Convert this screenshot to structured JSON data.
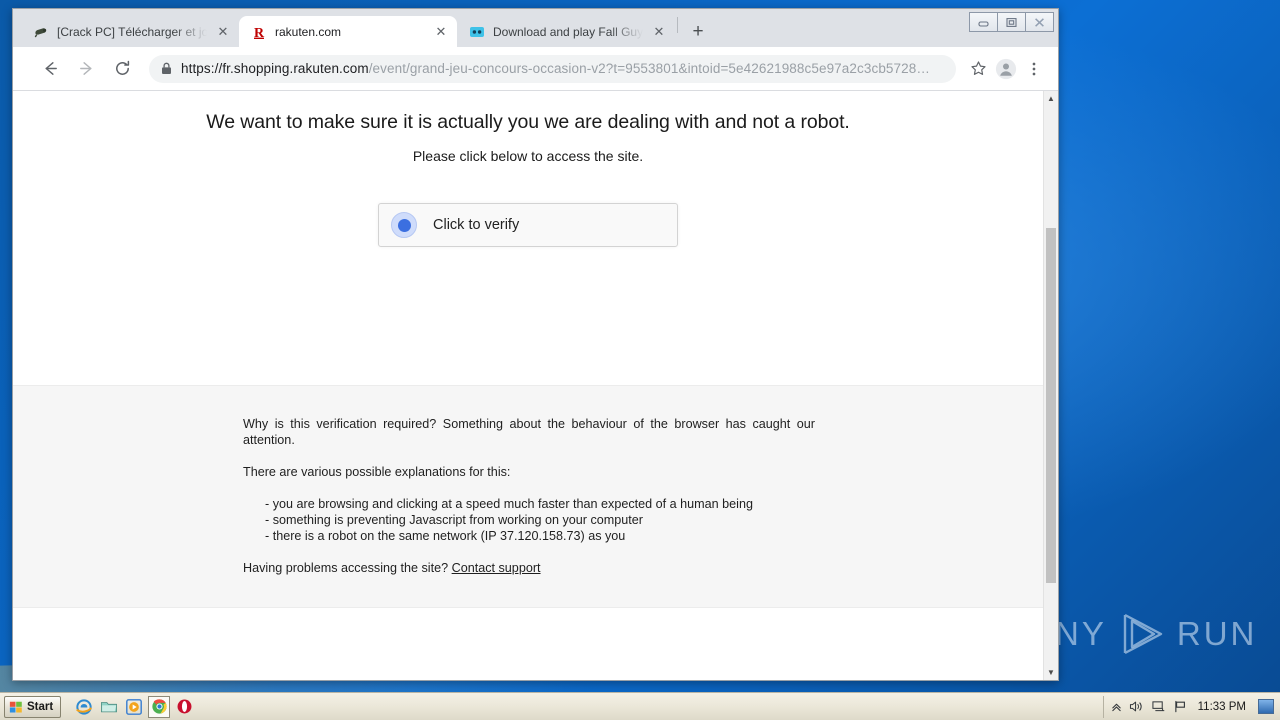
{
  "window": {
    "controls": [
      {
        "name": "minimize",
        "glyph": "minimize-icon"
      },
      {
        "name": "restore",
        "glyph": "restore-icon"
      },
      {
        "name": "close",
        "glyph": "close-icon"
      }
    ]
  },
  "browser": {
    "tabs": [
      {
        "title": "[Crack PC] Télécharger et jouer le je",
        "favicon": "gamepad-icon",
        "active": false
      },
      {
        "title": "rakuten.com",
        "favicon": "rakuten-r-icon",
        "active": true
      },
      {
        "title": "Download and play Fall Guys: Ultima",
        "favicon": "fallguys-icon",
        "active": false
      }
    ],
    "new_tab_label": "+",
    "tab_close_label": "✕",
    "nav": {
      "back": "back-arrow",
      "forward": "forward-arrow",
      "reload": "reload-icon"
    },
    "omnibox": {
      "lock": "lock-icon",
      "url_scheme_host": "https://fr.shopping.rakuten.com",
      "url_path": "/event/grand-jeu-concours-occasion-v2?t=9553801&intoid=5e42621988c5e97a2c3cb5728…",
      "url_full": "https://fr.shopping.rakuten.com/event/grand-jeu-concours-occasion-v2?t=9553801&intoid=5e42621988c5e97a2c3cb5728…"
    },
    "actions": {
      "bookmark": "star-icon",
      "profile": "avatar-icon",
      "menu": "three-dot-menu-icon"
    }
  },
  "page": {
    "headline": "We want to make sure it is actually you we are dealing with and not a robot.",
    "subline": "Please click below to access the site.",
    "verify_button_label": "Click to verify",
    "footer": {
      "why_paragraph": "Why is this verification required? Something about the behaviour of the browser has caught our attention.",
      "explanations_intro": "There are various possible explanations for this:",
      "explanations": [
        "- you are browsing and clicking at a speed much faster than expected of a human being",
        "- something is preventing Javascript from working on your computer",
        "- there is a robot on the same network (IP 37.120.158.73) as you"
      ],
      "help_prefix": "Having problems accessing the site? ",
      "contact_link": "Contact support"
    },
    "scrollbar": {
      "up_arrow": "▲",
      "down_arrow": "▼"
    }
  },
  "taskbar": {
    "start_label": "Start",
    "quicklaunch": [
      {
        "name": "internet-explorer-icon"
      },
      {
        "name": "file-explorer-icon"
      },
      {
        "name": "media-player-icon"
      },
      {
        "name": "google-chrome-icon"
      },
      {
        "name": "opera-icon"
      }
    ],
    "tray": [
      {
        "name": "show-hidden-icons-icon",
        "glyph": "«"
      },
      {
        "name": "volume-icon"
      },
      {
        "name": "network-icon"
      },
      {
        "name": "flag-action-center-icon"
      }
    ],
    "clock": "11:33 PM"
  },
  "watermark": {
    "left_text": "ANY",
    "right_text": "RUN"
  },
  "colors": {
    "desktop_blue": "#0a64c0",
    "chrome_tabstrip": "#dee1e6",
    "omnibox_bg": "#f1f3f4",
    "footer_bg": "#f6f6f6",
    "verify_accent": "#3b6fe0",
    "taskbar_bg": "#ece8da"
  }
}
